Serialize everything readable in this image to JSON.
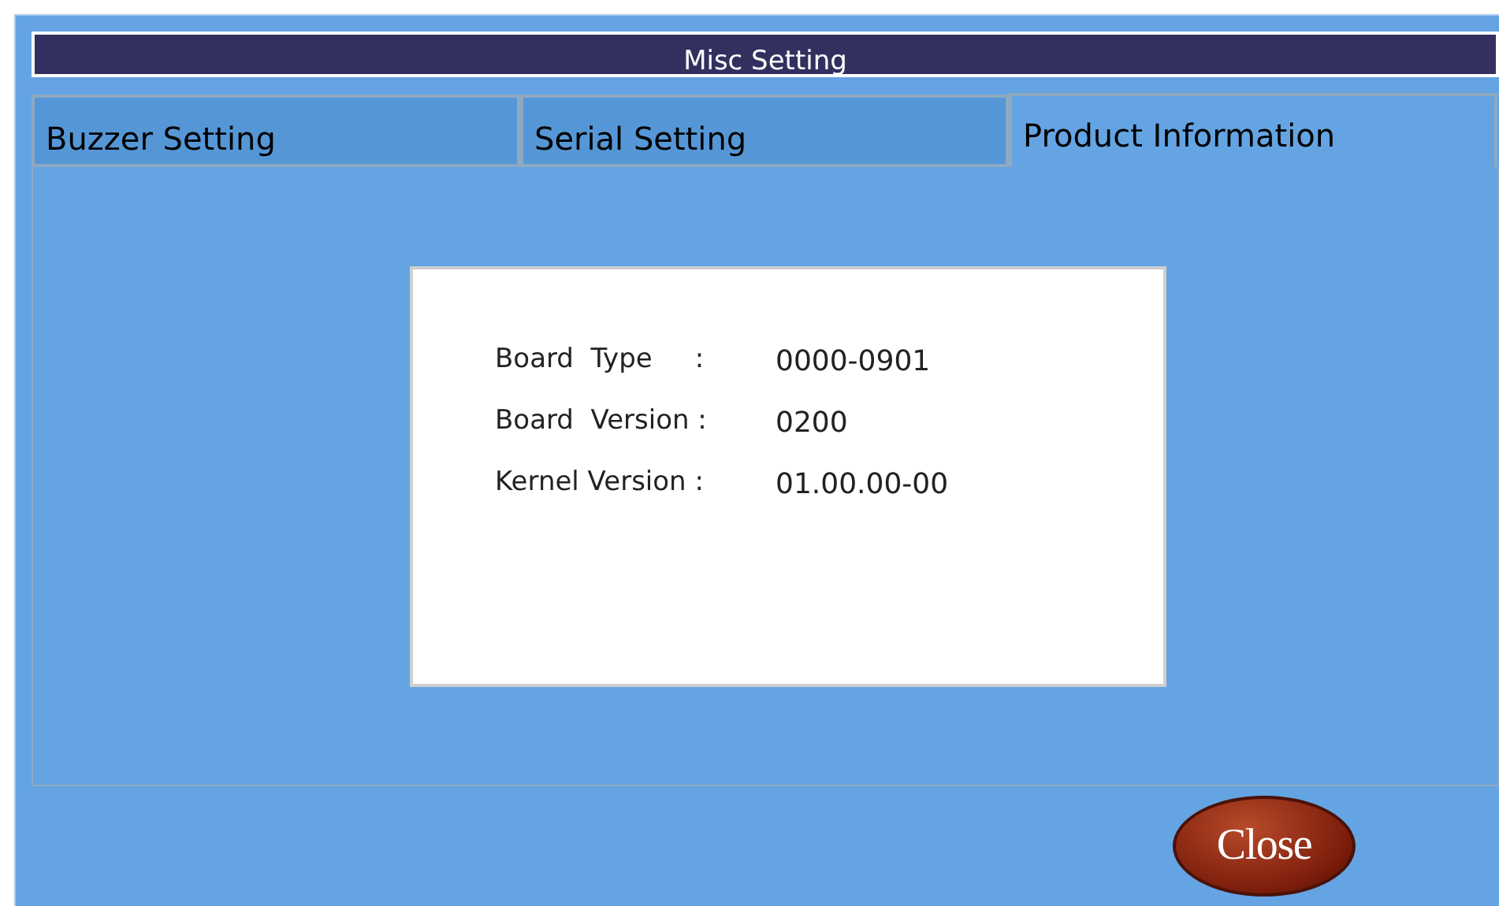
{
  "window": {
    "title": "Misc Setting"
  },
  "tabs": [
    {
      "label": "Buzzer Setting",
      "selected": false
    },
    {
      "label": "Serial Setting",
      "selected": false
    },
    {
      "label": "Product Information",
      "selected": true
    }
  ],
  "info": [
    {
      "label": "Board  Type     :",
      "value": "0000-0901"
    },
    {
      "label": "Board  Version :",
      "value": "0200"
    },
    {
      "label": "Kernel Version :",
      "value": "01.00.00-00"
    }
  ],
  "close_button": {
    "label": "Close"
  }
}
